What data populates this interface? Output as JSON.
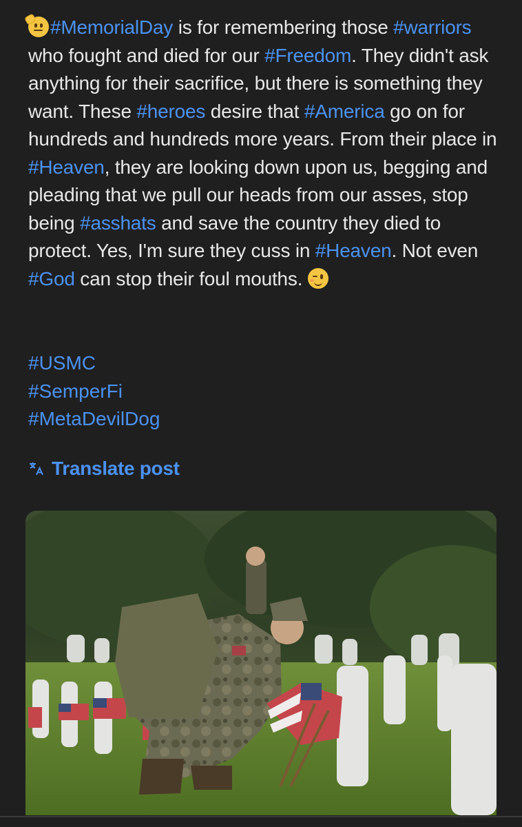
{
  "post": {
    "segments": [
      {
        "t": "#MemorialDay",
        "tag": true
      },
      {
        "t": " is for remembering those ",
        "tag": false
      },
      {
        "t": "#warriors",
        "tag": true
      },
      {
        "t": " who fought and died for our ",
        "tag": false
      },
      {
        "t": "#Freedom",
        "tag": true
      },
      {
        "t": ". They didn't ask anything for their sacrifice, but there is something they want. These ",
        "tag": false
      },
      {
        "t": "#heroes",
        "tag": true
      },
      {
        "t": " desire that ",
        "tag": false
      },
      {
        "t": "#America",
        "tag": true
      },
      {
        "t": " go on for hundreds and hundreds more years. From their place in ",
        "tag": false
      },
      {
        "t": "#Heaven",
        "tag": true
      },
      {
        "t": ", they are looking down upon us, begging and pleading that we pull our heads from our asses, stop being ",
        "tag": false
      },
      {
        "t": "#asshats",
        "tag": true
      },
      {
        "t": " and save the country they died to protect. Yes, I'm sure they cuss in ",
        "tag": false
      },
      {
        "t": "#Heaven",
        "tag": true
      },
      {
        "t": ". Not even ",
        "tag": false
      },
      {
        "t": "#God",
        "tag": true
      },
      {
        "t": " can stop their foul mouths. ",
        "tag": false
      }
    ],
    "tags": [
      "#USMC",
      "#SemperFi",
      "#MetaDevilDog"
    ],
    "leading_emoji": "saluting-face-emoji",
    "trailing_emoji": "winking-face-emoji"
  },
  "translate": {
    "label": "Translate post",
    "icon": "translate-icon"
  },
  "colors": {
    "background": "#1f1f1f",
    "text": "#e8e8e8",
    "link": "#4b92f2"
  }
}
